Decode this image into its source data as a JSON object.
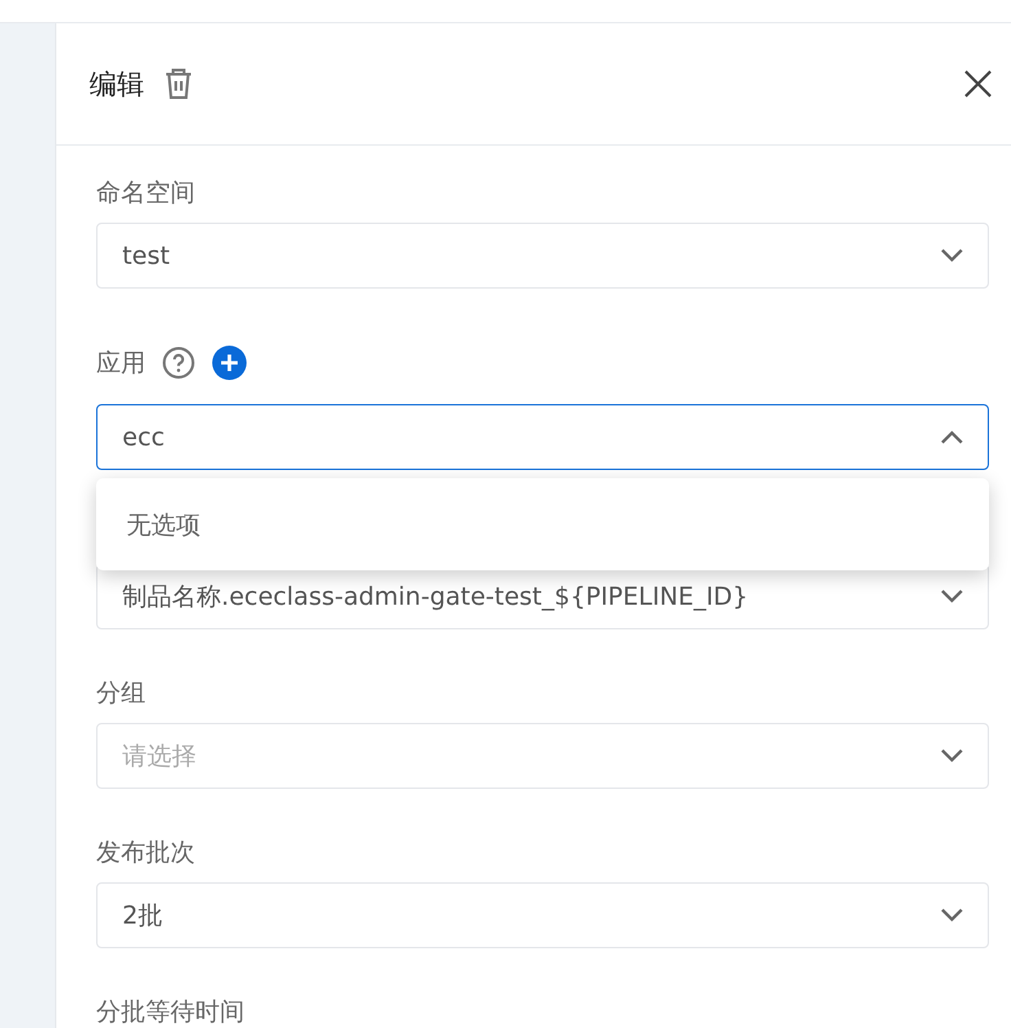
{
  "header": {
    "title": "编辑"
  },
  "fields": [
    {
      "label": "命名空间",
      "value": "test",
      "expanded": false,
      "focused": false
    },
    {
      "label": "应用",
      "value": "ecc",
      "expanded": true,
      "focused": true,
      "help": true,
      "add": true,
      "dropdown": {
        "empty_text": "无选项"
      }
    },
    {
      "value": "制品名称.ececlass-admin-gate-test_${PIPELINE_ID}",
      "expanded": false,
      "focused": false
    },
    {
      "label": "分组",
      "placeholder": "请选择",
      "expanded": false,
      "focused": false
    },
    {
      "label": "发布批次",
      "value": "2批",
      "expanded": false,
      "focused": false
    },
    {
      "label": "分批等待时间"
    }
  ]
}
